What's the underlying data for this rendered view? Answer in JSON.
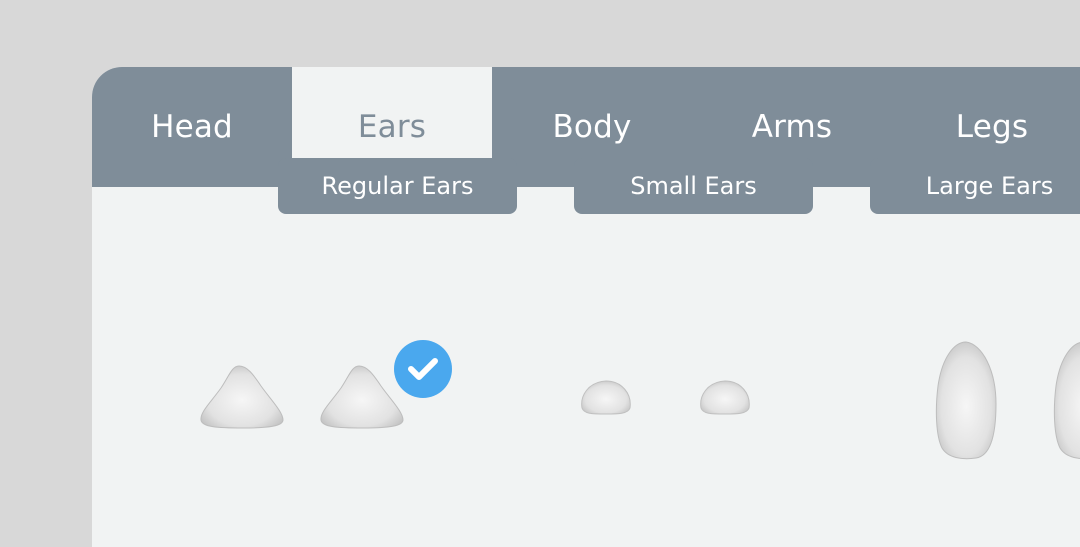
{
  "tabs": [
    {
      "label": "Head",
      "active": false
    },
    {
      "label": "Ears",
      "active": true
    },
    {
      "label": "Body",
      "active": false
    },
    {
      "label": "Arms",
      "active": false
    },
    {
      "label": "Legs",
      "active": false
    }
  ],
  "variants": [
    {
      "label": "Regular Ears",
      "selected": true
    },
    {
      "label": "Small Ears",
      "selected": false
    },
    {
      "label": "Large Ears",
      "selected": false
    }
  ],
  "selection_icon": "checkmark-icon",
  "colors": {
    "tab_bar": "#7f8d99",
    "panel_bg": "#f1f3f3",
    "page_bg": "#d8d8d8",
    "check_badge": "#4aa8ee"
  }
}
